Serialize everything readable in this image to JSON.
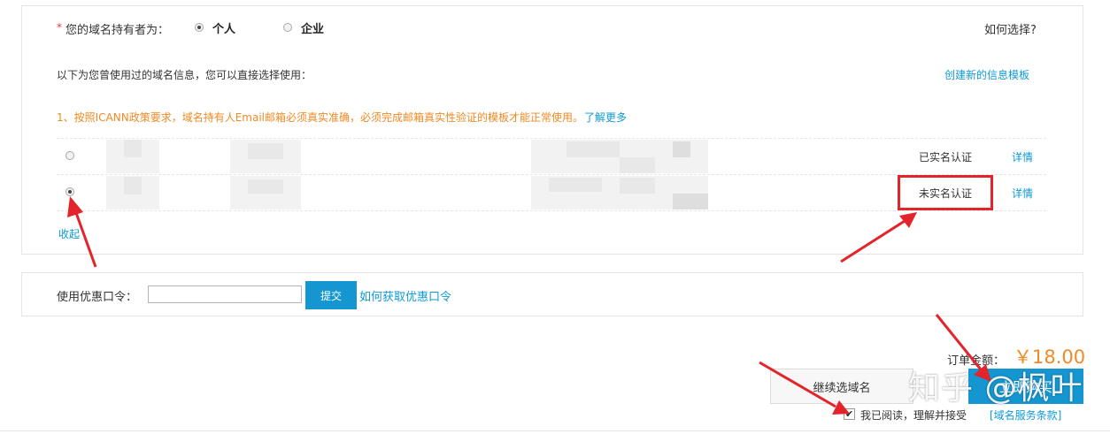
{
  "holder": {
    "required_mark": "*",
    "label": "您的域名持有者为：",
    "options": [
      {
        "label": "个人",
        "checked": true
      },
      {
        "label": "企业",
        "checked": false
      }
    ],
    "how_to_choose": "如何选择?"
  },
  "history": {
    "intro": "以下为您曾使用过的域名信息，您可以直接选择使用：",
    "create_template": "创建新的信息模板",
    "notice": "1、按照ICANN政策要求，域名持有人Email邮箱必须真实准确，必须完成邮箱真实性验证的模板才能正常使用。",
    "learn_more": "了解更多",
    "rows": [
      {
        "status": "已实名认证",
        "detail": "详情",
        "selected": false
      },
      {
        "status": "未实名认证",
        "detail": "详情",
        "selected": true
      }
    ],
    "collapse": "收起"
  },
  "coupon": {
    "label": "使用优惠口令：",
    "value": "",
    "submit": "提交",
    "how_to_get": "如何获取优惠口令"
  },
  "order": {
    "total_label": "订单金额：",
    "total_value": "￥18.00",
    "continue": "继续选域名",
    "buy": "立即购买",
    "agree_checked": true,
    "agree_text": "我已阅读，理解并接受",
    "terms": "[域名服务条款]"
  },
  "watermark": "知乎 @枫叶",
  "colors": {
    "accent": "#1596d0",
    "warning": "#f08a24",
    "price": "#f08a24",
    "annotation": "#e3242b"
  }
}
